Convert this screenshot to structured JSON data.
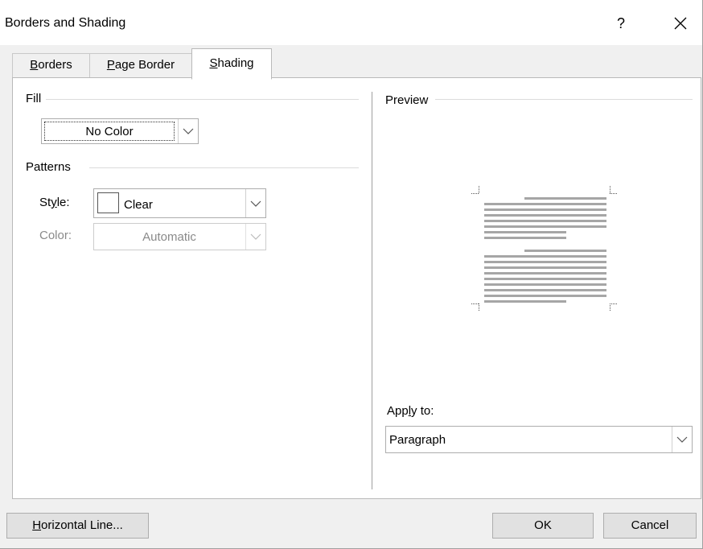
{
  "dialog": {
    "title": "Borders and Shading",
    "help_label": "?"
  },
  "tabs": [
    {
      "label": "Borders",
      "underline": "B",
      "rest": "orders"
    },
    {
      "label": "Page Border",
      "underline": "P",
      "rest": "age Border"
    },
    {
      "label": "Shading",
      "underline": "S",
      "rest": "hading"
    }
  ],
  "fill": {
    "group_label": "Fill",
    "value": "No Color"
  },
  "patterns": {
    "group_label": "Patterns",
    "style_label_pre": "St",
    "style_label_ul": "y",
    "style_label_post": "le:",
    "style_value": "Clear",
    "color_label": "Color:",
    "color_value": "Automatic"
  },
  "preview": {
    "group_label": "Preview"
  },
  "apply_to": {
    "label_pre": "App",
    "label_ul": "l",
    "label_post": "y to:",
    "value": "Paragraph"
  },
  "buttons": {
    "horizontal_line_ul": "H",
    "horizontal_line_rest": "orizontal Line...",
    "ok": "OK",
    "cancel": "Cancel"
  },
  "colors": {
    "preview_line": "#a6a6a6",
    "disabled_text": "#8a8a8a"
  }
}
